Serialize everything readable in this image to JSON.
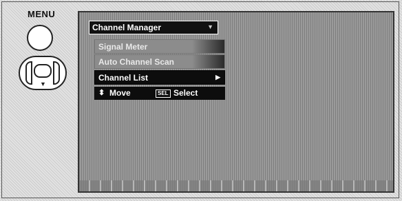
{
  "remote": {
    "menu_label": "MENU",
    "icons": {
      "menu_button": "menu-button-circle",
      "dpad": "dpad",
      "down": "▼"
    }
  },
  "osd": {
    "title": "Channel Manager",
    "title_caret": "▼",
    "items": [
      {
        "label": "Signal Meter",
        "state": "dimmed"
      },
      {
        "label": "Auto Channel Scan",
        "state": "dimmed"
      },
      {
        "label": "Channel List",
        "state": "highlighted",
        "arrow": "▶"
      }
    ],
    "help": {
      "updown_icon": "⬍",
      "move": "Move",
      "sel_key": "SEL",
      "select": "Select"
    }
  },
  "colors": {
    "highlight_bg": "#0d0d0d",
    "dim_item_bg": "#8c8c8c",
    "screen_bg": "#9a9a9a"
  }
}
